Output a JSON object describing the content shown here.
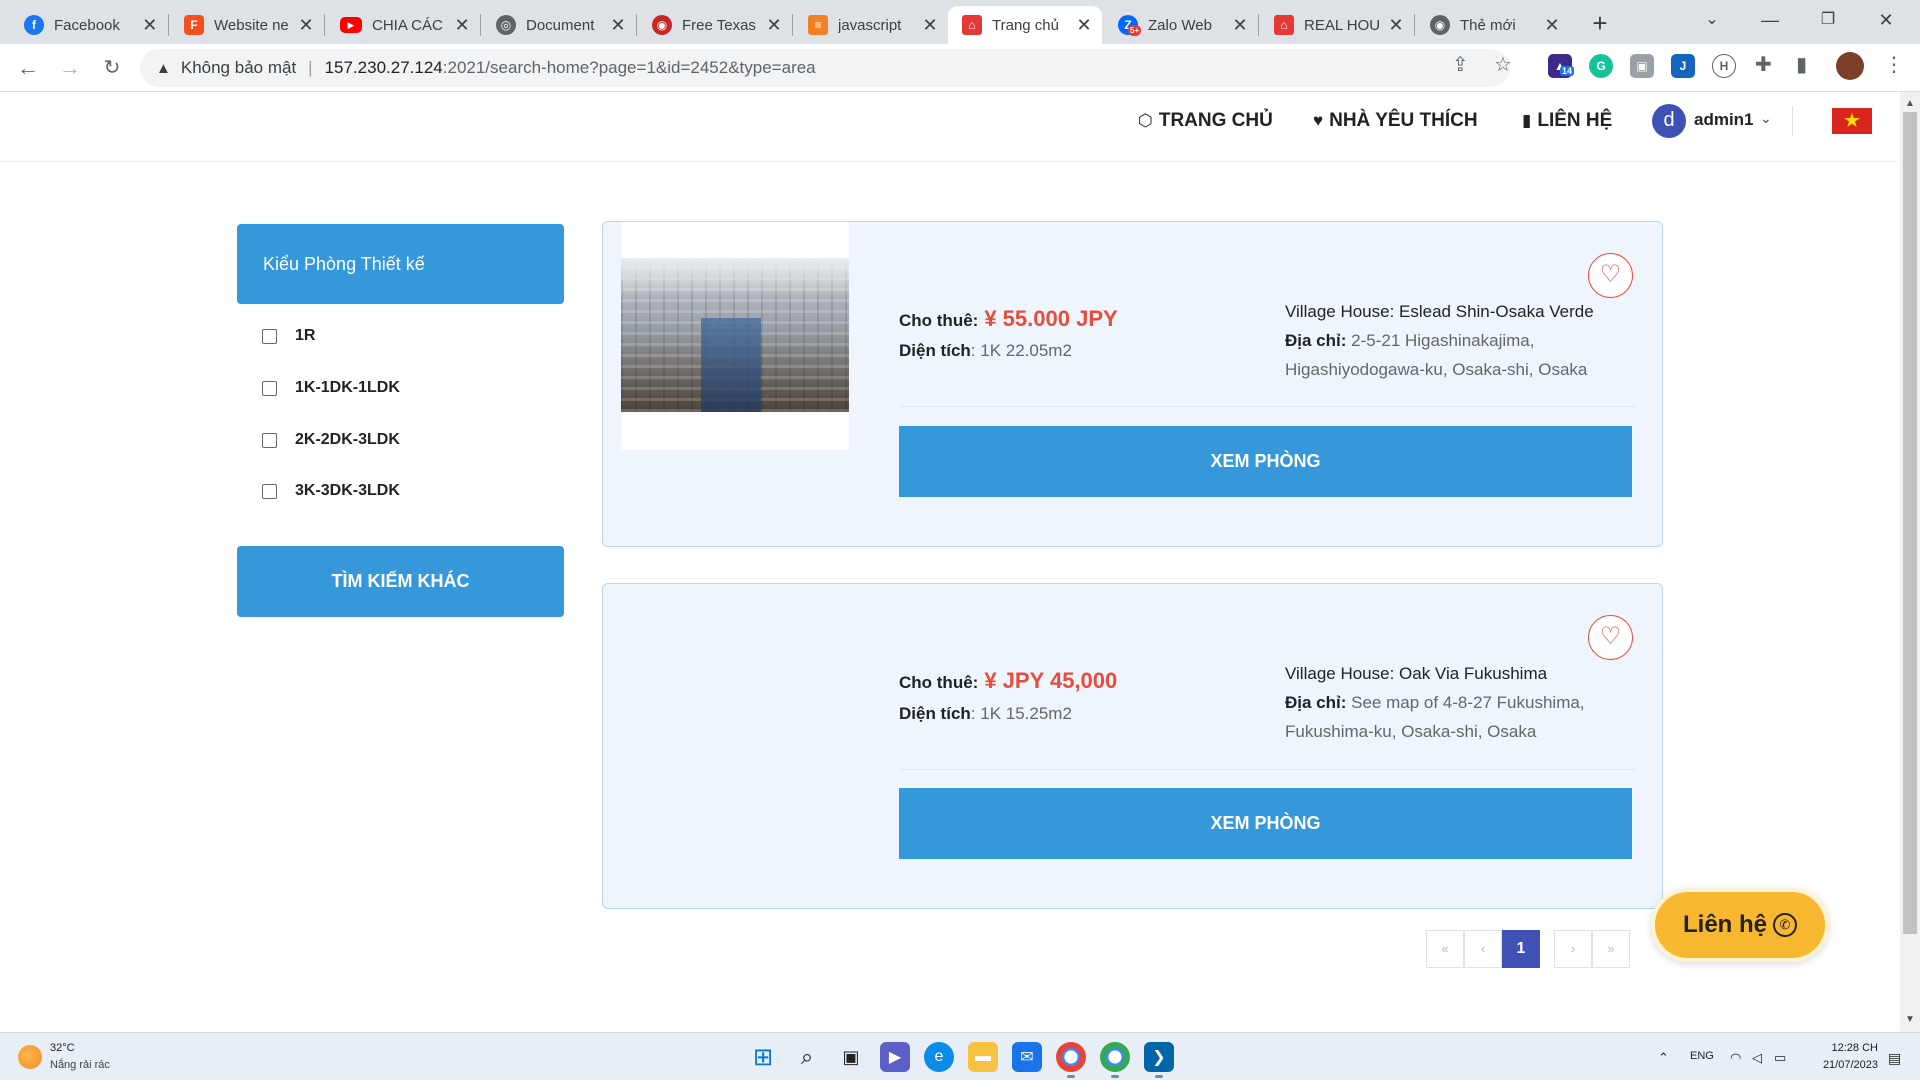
{
  "browser": {
    "tabs": [
      {
        "label": "Facebook",
        "icon": "facebook-icon",
        "color": "#1877f2"
      },
      {
        "label": "Website ne",
        "icon": "figma-icon",
        "color": "#f24e1e"
      },
      {
        "label": "CHIA CÁC",
        "icon": "youtube-icon",
        "color": "#ff0000"
      },
      {
        "label": "Document",
        "icon": "globe-icon",
        "color": "#5f6368"
      },
      {
        "label": "Free Texas",
        "icon": "texas-icon",
        "color": "#c62828"
      },
      {
        "label": "javascript",
        "icon": "stackoverflow-icon",
        "color": "#f48024"
      },
      {
        "label": "Trang chủ",
        "icon": "home-icon",
        "color": "#e53935"
      },
      {
        "label": "Zalo Web",
        "icon": "zalo-icon",
        "color": "#0068ff"
      },
      {
        "label": "REAL HOU",
        "icon": "home-icon",
        "color": "#e53935"
      },
      {
        "label": "Thẻ mới",
        "icon": "chrome-icon",
        "color": "#5f6368"
      }
    ],
    "zalo_badge": "5+",
    "address": {
      "security_label": "Không bảo mật",
      "host": "157.230.27.124",
      "rest": ":2021/search-home?page=1&id=2452&type=area"
    },
    "ext_badge": "14"
  },
  "header": {
    "nav": [
      {
        "label": "TRANG CHỦ",
        "icon": "building-icon"
      },
      {
        "label": "NHÀ YÊU THÍCH",
        "icon": "heart-icon"
      },
      {
        "label": "LIÊN HỆ",
        "icon": "book-icon"
      }
    ],
    "user": {
      "initial": "d",
      "name": "admin1"
    },
    "flag_star": "★"
  },
  "sidebar": {
    "filter_title": "Kiểu Phòng Thiết kế",
    "options": [
      "1R",
      "1K-1DK-1LDK",
      "2K-2DK-3LDK",
      "3K-3DK-3LDK"
    ],
    "search_other": "TÌM KIẾM KHÁC"
  },
  "listings": [
    {
      "rent_label": "Cho thuê:",
      "price": "¥ 55.000 JPY",
      "area_label": "Diện tích",
      "area_value": ": 1K 22.05m2",
      "name": "Village House: Eslead Shin-Osaka Verde",
      "address_label": "Địa chỉ:",
      "address": "2-5-21 Higashinakajima, Higashiyodogawa-ku, Osaka-shi, Osaka",
      "button": "XEM PHÒNG",
      "has_photo": true
    },
    {
      "rent_label": "Cho thuê:",
      "price": "¥ JPY 45,000",
      "area_label": "Diện tích",
      "area_value": ": 1K 15.25m2",
      "name": "Village House: Oak Via Fukushima",
      "address_label": "Địa chỉ:",
      "address": "See map of 4-8-27 Fukushima, Fukushima-ku, Osaka-shi, Osaka",
      "button": "XEM PHÒNG",
      "has_photo": false
    }
  ],
  "pagination": {
    "first": "«",
    "prev": "‹",
    "current": "1",
    "next": "›",
    "last": "»"
  },
  "floating_contact": {
    "label": "Liên hệ"
  },
  "taskbar": {
    "weather_temp": "32°C",
    "weather_desc": "Nắng rải rác",
    "lang": "ENG",
    "time": "12:28 CH",
    "date": "21/07/2023",
    "apps": [
      "windows-start-icon",
      "search-icon",
      "task-view-icon",
      "teams-icon",
      "edge-icon",
      "file-explorer-icon",
      "mail-icon",
      "chrome-icon",
      "chrome-icon",
      "vscode-icon"
    ]
  },
  "colors": {
    "primary": "#3498db",
    "price": "#e74c3c",
    "pager_active": "#3f51b5",
    "contact_button": "#f7b731"
  }
}
